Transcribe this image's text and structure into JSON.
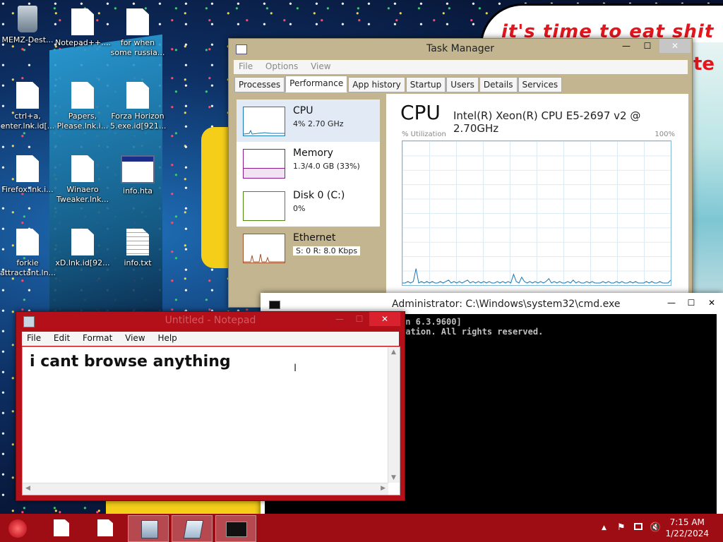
{
  "desktop": {
    "wallpaper_text": "it's time to eat shit",
    "icons": [
      {
        "label": "MEMZ-Dest...",
        "icon": "recycle-bin-icon"
      },
      {
        "label": "Notepad++....",
        "icon": "document-icon"
      },
      {
        "label": "for when some russia...",
        "icon": "document-icon"
      },
      {
        "label": "ctrl+a, enter.lnk.id[...",
        "icon": "document-icon"
      },
      {
        "label": "Papers, Please.lnk.i...",
        "icon": "document-icon"
      },
      {
        "label": "Forza Horizon 5.exe.id[921...",
        "icon": "document-icon"
      },
      {
        "label": "Firefox.lnk.i...",
        "icon": "document-icon"
      },
      {
        "label": "Winaero Tweaker.lnk...",
        "icon": "document-icon"
      },
      {
        "label": "info.hta",
        "icon": "hta-file-icon"
      },
      {
        "label": "forkie attractant.ln...",
        "icon": "document-icon"
      },
      {
        "label": "xD.lnk.id[92...",
        "icon": "document-icon"
      },
      {
        "label": "info.txt",
        "icon": "text-file-icon"
      }
    ]
  },
  "taskmgr": {
    "title": "Task Manager",
    "menu": [
      "File",
      "Options",
      "View"
    ],
    "tabs": [
      "Processes",
      "Performance",
      "App history",
      "Startup",
      "Users",
      "Details",
      "Services"
    ],
    "active_tab": "Performance",
    "resources": [
      {
        "name": "CPU",
        "value": "4% 2.70 GHz",
        "color": "#1a78b4"
      },
      {
        "name": "Memory",
        "value": "1.3/4.0 GB (33%)",
        "color": "#8b1a8f"
      },
      {
        "name": "Disk 0 (C:)",
        "value": "0%",
        "color": "#4f8a10"
      },
      {
        "name": "Ethernet",
        "value": "S: 0 R: 8.0 Kbps",
        "color": "#a0522d"
      }
    ],
    "graph": {
      "title": "CPU",
      "cpu_name": "Intel(R) Xeon(R) CPU E5-2697 v2 @ 2.70GHz",
      "util_label": "% Utilization",
      "max_label": "100%",
      "utilization": [
        1,
        1,
        2,
        1,
        2,
        11,
        1,
        2,
        1,
        2,
        1,
        2,
        1,
        1,
        2,
        1,
        2,
        3,
        1,
        2,
        1,
        2,
        1,
        2,
        3,
        1,
        2,
        1,
        2,
        1,
        2,
        1,
        2,
        1,
        1,
        2,
        1,
        2,
        1,
        2,
        1,
        7,
        2,
        1,
        5,
        2,
        1,
        2,
        1,
        2,
        1,
        2,
        1,
        2,
        4,
        1,
        2,
        1,
        2,
        1,
        1,
        2,
        1,
        3,
        1,
        2,
        1,
        1,
        2,
        1,
        2,
        1,
        1,
        1,
        2,
        1,
        2,
        1,
        1,
        2,
        1,
        2,
        1,
        1,
        2,
        1,
        2,
        1,
        1,
        1,
        2,
        1,
        2,
        1,
        1,
        2,
        1,
        1,
        1,
        3
      ]
    }
  },
  "cmd": {
    "title": "Administrator: C:\\Windows\\system32\\cmd.exe",
    "lines": [
      "on 6.3.9600]",
      "ration. All rights reserved."
    ]
  },
  "notepad": {
    "title": "Untitled - Notepad",
    "menu": [
      "File",
      "Edit",
      "Format",
      "View",
      "Help"
    ],
    "content": "i cant browse anything"
  },
  "taskbar": {
    "clock_time": "7:15 AM",
    "clock_date": "1/22/2024",
    "tray_up": "▲",
    "tray_flag": "⚑",
    "tray_volume": "🔇"
  }
}
